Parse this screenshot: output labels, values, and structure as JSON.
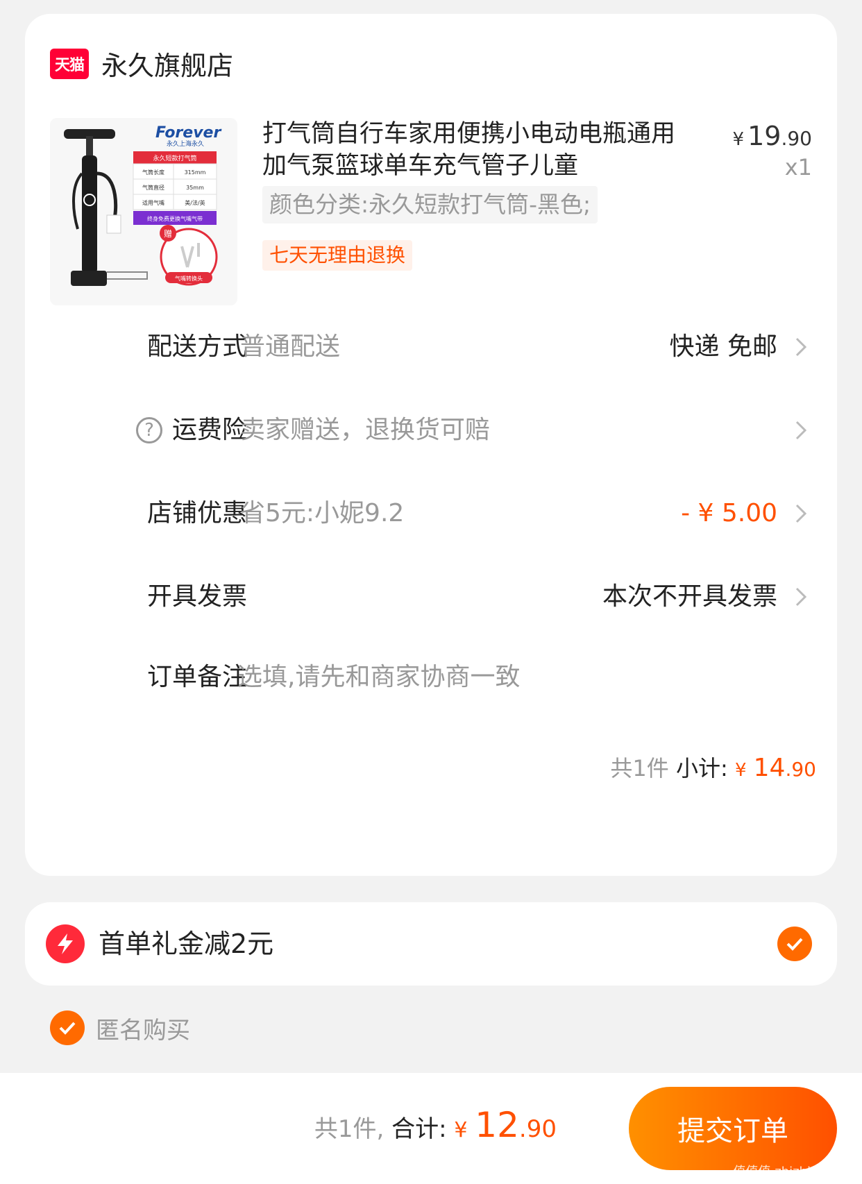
{
  "store": {
    "logo_text": "天猫",
    "name": "永久旗舰店"
  },
  "product": {
    "title": "打气筒自行车家用便携小电动电瓶通用加气泵篮球单车充气管子儿童",
    "price_currency": "¥",
    "price_int": "19",
    "price_dec": ".90",
    "quantity": "x1",
    "sku": "颜色分类:永久短款打气筒-黑色;",
    "tag": "七天无理由退换",
    "image": {
      "brand": "Forever",
      "brand_sub": "永久上海永久",
      "spec_title": "永久短款打气筒",
      "spec_rows": [
        [
          "气筒长度",
          "315mm"
        ],
        [
          "气筒直径",
          "35mm"
        ],
        [
          "适用气嘴",
          "美/法/英"
        ]
      ],
      "banner": "终身免费更换气嘴气带",
      "gift_badge": "赠",
      "gift_caption": "气嘴转换头"
    }
  },
  "rows": {
    "delivery": {
      "label": "配送方式",
      "value": "普通配送",
      "right": "快递 免邮"
    },
    "insurance": {
      "label": "运费险",
      "value": "卖家赠送，退换货可赔"
    },
    "discount": {
      "label": "店铺优惠",
      "value": "省5元:小妮9.2",
      "right": "- ¥ 5.00"
    },
    "invoice": {
      "label": "开具发票",
      "right": "本次不开具发票"
    },
    "note": {
      "label": "订单备注",
      "placeholder": "选填,请先和商家协商一致"
    }
  },
  "subtotal": {
    "count": "共1件",
    "label": "小计:",
    "currency": "¥",
    "int": "14",
    "dec": ".90"
  },
  "gift": {
    "text": "首单礼金减2元"
  },
  "anonymous": {
    "text": "匿名购买"
  },
  "footer": {
    "count": "共1件,",
    "label": "合计:",
    "currency": "¥",
    "int": "12",
    "dec": ".90",
    "submit": "提交订单",
    "watermark": "值值值 zhizhizhi.com"
  },
  "colors": {
    "accent": "#ff5000",
    "tmall_red": "#ff0036",
    "check_orange": "#ff6a00"
  }
}
